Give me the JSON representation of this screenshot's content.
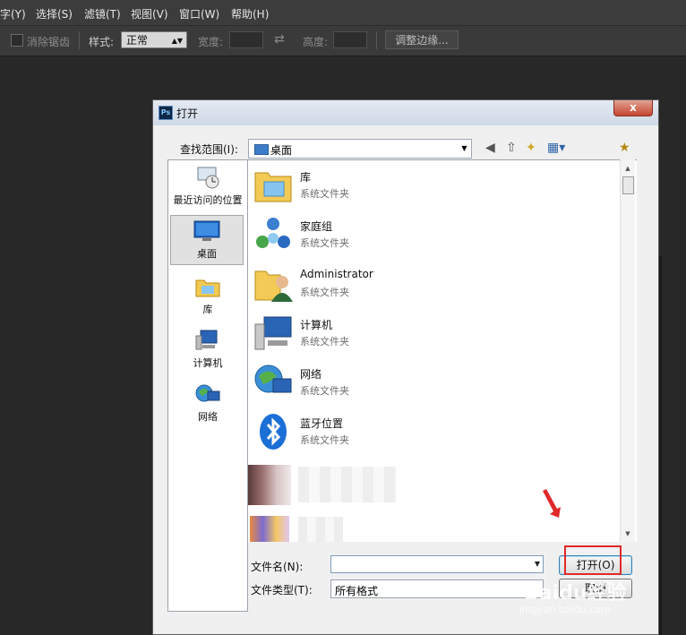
{
  "menubar": {
    "items": [
      "字(Y)",
      "选择(S)",
      "滤镜(T)",
      "视图(V)",
      "窗口(W)",
      "帮助(H)"
    ]
  },
  "optionsbar": {
    "antialias_label": "消除锯齿",
    "style_label": "样式:",
    "style_value": "正常",
    "width_label": "宽度:",
    "height_label": "高度:",
    "refine_edge_button": "调整边缘..."
  },
  "dialog": {
    "title": "打开",
    "close_glyph": "x",
    "look_in_label": "查找范围(I):",
    "look_in_value": "桌面",
    "places": [
      {
        "label": "最近访问的位置",
        "icon": "recent-places-icon"
      },
      {
        "label": "桌面",
        "icon": "desktop-icon",
        "selected": true
      },
      {
        "label": "库",
        "icon": "libraries-icon"
      },
      {
        "label": "计算机",
        "icon": "computer-icon"
      },
      {
        "label": "网络",
        "icon": "network-icon"
      }
    ],
    "files": [
      {
        "name": "库",
        "type": "系统文件夹",
        "icon": "libraries-folder-icon"
      },
      {
        "name": "家庭组",
        "type": "系统文件夹",
        "icon": "homegroup-icon"
      },
      {
        "name": "Administrator",
        "type": "系统文件夹",
        "icon": "user-folder-icon"
      },
      {
        "name": "计算机",
        "type": "系统文件夹",
        "icon": "computer-icon"
      },
      {
        "name": "网络",
        "type": "系统文件夹",
        "icon": "network-icon"
      },
      {
        "name": "蓝牙位置",
        "type": "系统文件夹",
        "icon": "bluetooth-icon"
      }
    ],
    "filename_label": "文件名(N):",
    "filename_value": "",
    "filetype_label": "文件类型(T):",
    "filetype_value": "所有格式",
    "open_button": "打开(O)",
    "cancel_button": "取消"
  },
  "watermark": {
    "logo": "Baidu经验",
    "url": "jingyan.baidu.com"
  },
  "colors": {
    "highlight_box": "#e0282a",
    "app_background": "#282828",
    "dialog_bg": "#f0f0f0"
  }
}
